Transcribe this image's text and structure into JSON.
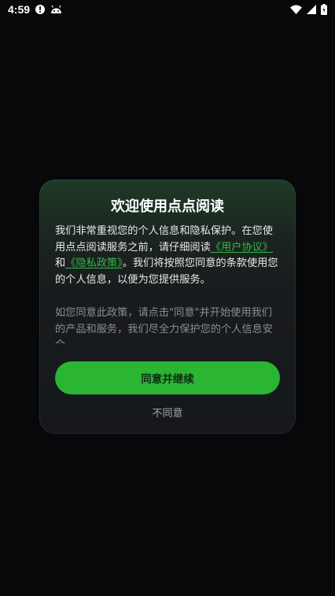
{
  "status_bar": {
    "time": "4:59",
    "icons": [
      "alert-icon",
      "android-icon",
      "wifi-icon",
      "signal-icon",
      "battery-icon"
    ]
  },
  "dialog": {
    "title": "欢迎使用点点阅读",
    "body_part1": "我们非常重视您的个人信息和隐私保护。在您使用点点阅读服务之前，请仔细阅读",
    "user_agreement_link": "《用户协议》",
    "body_and": "和",
    "privacy_policy_link": "《隐私政策》",
    "body_part2": "。我们将按照您同意的条款使用您的个人信息，以便为您提供服务。",
    "sub_text": "如您同意此政策，请点击\"同意\"并开始使用我们的产品和服务，我们尽全力保护您的个人信息安全。",
    "agree_label": "同意并继续",
    "disagree_label": "不同意"
  },
  "colors": {
    "background": "#07080a",
    "accent": "#2ab532",
    "link": "#35b84a"
  }
}
